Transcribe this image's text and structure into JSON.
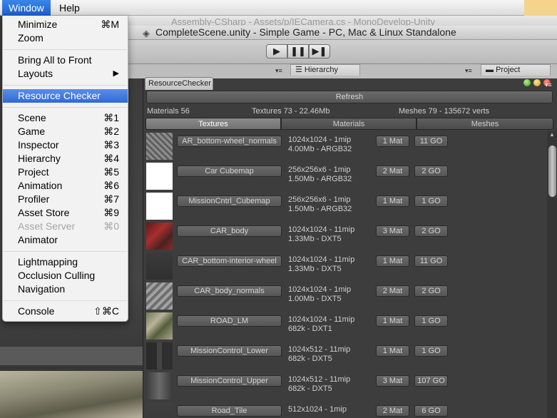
{
  "menubar": {
    "items": [
      "Window",
      "Help"
    ]
  },
  "background_windows": {
    "monodevelop_title": "Assembly-CSharp - Assets/p/IECamera.cs - MonoDevelop-Unity",
    "unity_title": "CompleteScene.unity - Simple Game - PC, Mac & Linux Standalone",
    "unity_icon": "unity-icon",
    "toolbar": {
      "play": "▶",
      "pause": "❚❚",
      "step": "▶❚"
    },
    "pane_menu": "▾≡",
    "tabs": {
      "hierarchy": "Hierarchy",
      "project": "Project"
    }
  },
  "window_menu": {
    "items": [
      {
        "label": "Minimize",
        "shortcut": "⌘M",
        "enabled": true
      },
      {
        "label": "Zoom",
        "shortcut": "",
        "enabled": true
      },
      {
        "label": "Bring All to Front",
        "shortcut": "",
        "enabled": true
      },
      {
        "label": "Layouts",
        "shortcut": "▶",
        "enabled": true
      },
      {
        "label": "Resource Checker",
        "shortcut": "",
        "enabled": true,
        "highlighted": true
      },
      {
        "label": "Scene",
        "shortcut": "⌘1",
        "enabled": true
      },
      {
        "label": "Game",
        "shortcut": "⌘2",
        "enabled": true
      },
      {
        "label": "Inspector",
        "shortcut": "⌘3",
        "enabled": true
      },
      {
        "label": "Hierarchy",
        "shortcut": "⌘4",
        "enabled": true
      },
      {
        "label": "Project",
        "shortcut": "⌘5",
        "enabled": true
      },
      {
        "label": "Animation",
        "shortcut": "⌘6",
        "enabled": true
      },
      {
        "label": "Profiler",
        "shortcut": "⌘7",
        "enabled": true
      },
      {
        "label": "Asset Store",
        "shortcut": "⌘9",
        "enabled": true
      },
      {
        "label": "Asset Server",
        "shortcut": "⌘0",
        "enabled": false
      },
      {
        "label": "Animator",
        "shortcut": "",
        "enabled": true
      },
      {
        "label": "Lightmapping",
        "shortcut": "",
        "enabled": true
      },
      {
        "label": "Occlusion Culling",
        "shortcut": "",
        "enabled": true
      },
      {
        "label": "Navigation",
        "shortcut": "",
        "enabled": true
      },
      {
        "label": "Console",
        "shortcut": "⇧⌘C",
        "enabled": true
      }
    ]
  },
  "resource_checker": {
    "tab_title": "ResourceChecker",
    "refresh_label": "Refresh",
    "stats": {
      "materials": "Materials 56",
      "textures": "Textures 73 - 22.46Mb",
      "meshes": "Meshes 79 - 135672 verts"
    },
    "toggles": {
      "textures": "Textures",
      "materials": "Materials",
      "meshes": "Meshes"
    },
    "rows": [
      {
        "name": "AR_bottom-wheel_normals",
        "info1": "1024x1024 - 1mip",
        "info2": "4.00Mb - ARGB32",
        "mat": "1 Mat",
        "go": "11 GO",
        "thumb": "noise"
      },
      {
        "name": "Car Cubemap",
        "info1": "256x256x6 - 1mip",
        "info2": "1.50Mb - ARGB32",
        "mat": "2 Mat",
        "go": "2 GO",
        "thumb": "white"
      },
      {
        "name": "MissionCntrl_Cubemap",
        "info1": "256x256x6 - 1mip",
        "info2": "1.50Mb - ARGB32",
        "mat": "1 Mat",
        "go": "1 GO",
        "thumb": "white"
      },
      {
        "name": "CAR_body",
        "info1": "1024x1024 - 11mip",
        "info2": "1.33Mb - DXT5",
        "mat": "3 Mat",
        "go": "2 GO",
        "thumb": "red"
      },
      {
        "name": "CAR_bottom-interior-wheel",
        "info1": "1024x1024 - 11mip",
        "info2": "1.33Mb - DXT5",
        "mat": "1 Mat",
        "go": "11 GO",
        "thumb": "dark"
      },
      {
        "name": "CAR_body_normals",
        "info1": "1024x1024 - 1mip",
        "info2": "1.00Mb - DXT5",
        "mat": "2 Mat",
        "go": "2 GO",
        "thumb": "grey"
      },
      {
        "name": "ROAD_LM",
        "info1": "1024x1024 - 11mip",
        "info2": "682k - DXT1",
        "mat": "1 Mat",
        "go": "1 GO",
        "thumb": "road"
      },
      {
        "name": "MissionControl_Lower",
        "info1": "1024x512 - 11mip",
        "info2": "682k - DXT5",
        "mat": "1 Mat",
        "go": "1 GO",
        "thumb": "mc1"
      },
      {
        "name": "MissionControl_Upper",
        "info1": "1024x512 - 11mip",
        "info2": "682k - DXT5",
        "mat": "3 Mat",
        "go": "107 GO",
        "thumb": "mc2"
      },
      {
        "name": "Road_Tile",
        "info1": "512x1024 - 1mip",
        "info2": "",
        "mat": "2 Mat",
        "go": "6 GO",
        "thumb": "tile"
      }
    ]
  }
}
